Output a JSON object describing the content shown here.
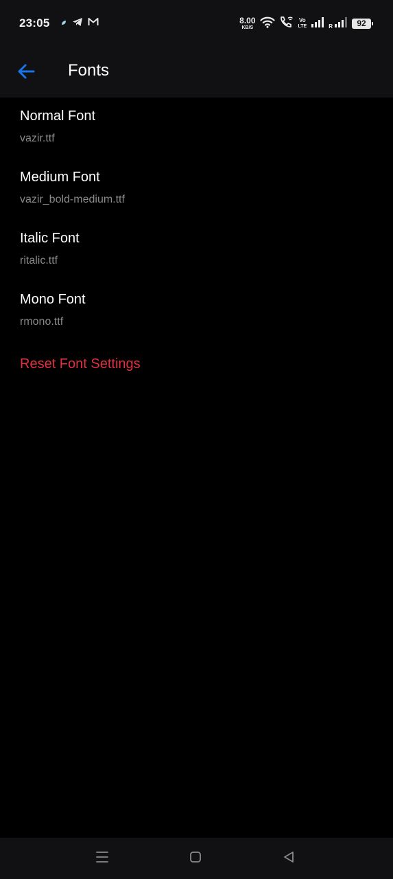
{
  "status_bar": {
    "time": "23:05",
    "speed_value": "8.00",
    "speed_unit": "KB/S",
    "volte_top": "Vo",
    "volte_bottom": "LTE",
    "roaming": "R",
    "battery": "92"
  },
  "app_bar": {
    "title": "Fonts",
    "back_icon": "arrow-left-icon",
    "accent_color": "#1a73e8"
  },
  "fonts": [
    {
      "title": "Normal Font",
      "file": "vazir.ttf"
    },
    {
      "title": "Medium Font",
      "file": "vazir_bold-medium.ttf"
    },
    {
      "title": "Italic Font",
      "file": "ritalic.ttf"
    },
    {
      "title": "Mono Font",
      "file": "rmono.ttf"
    }
  ],
  "reset": {
    "label": "Reset Font Settings",
    "color": "#e0303e"
  },
  "nav_bar": {
    "icons": [
      "menu-icon",
      "home-icon",
      "back-icon"
    ]
  }
}
